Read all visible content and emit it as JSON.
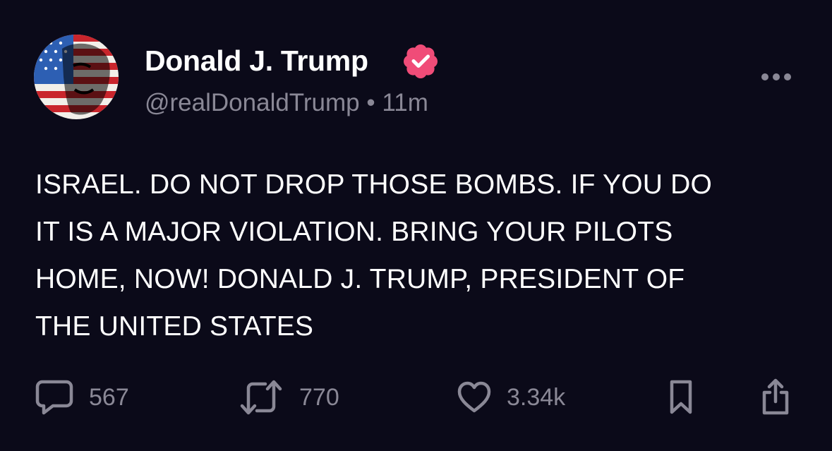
{
  "post": {
    "author": {
      "display_name": "Donald J. Trump",
      "handle": "@realDonaldTrump",
      "verified": true,
      "verified_badge_color": "#f04c78"
    },
    "separator": "•",
    "time_ago": "11m",
    "text": "ISRAEL. DO NOT DROP THOSE BOMBS. IF YOU DO\nIT IS A MAJOR VIOLATION. BRING YOUR PILOTS\nHOME, NOW! DONALD J. TRUMP, PRESIDENT OF\nTHE UNITED STATES",
    "actions": {
      "reply_count": "567",
      "repost_count": "770",
      "like_count": "3.34k"
    }
  },
  "icons": {
    "verified": "verified-badge-icon",
    "more": "more-horizontal-icon",
    "reply": "speech-bubble-icon",
    "repost": "repost-arrows-icon",
    "like": "heart-icon",
    "bookmark": "bookmark-icon",
    "share": "share-icon"
  },
  "colors": {
    "background": "#0b0a19",
    "primary_text": "#ffffff",
    "secondary_text": "#8a8896"
  }
}
